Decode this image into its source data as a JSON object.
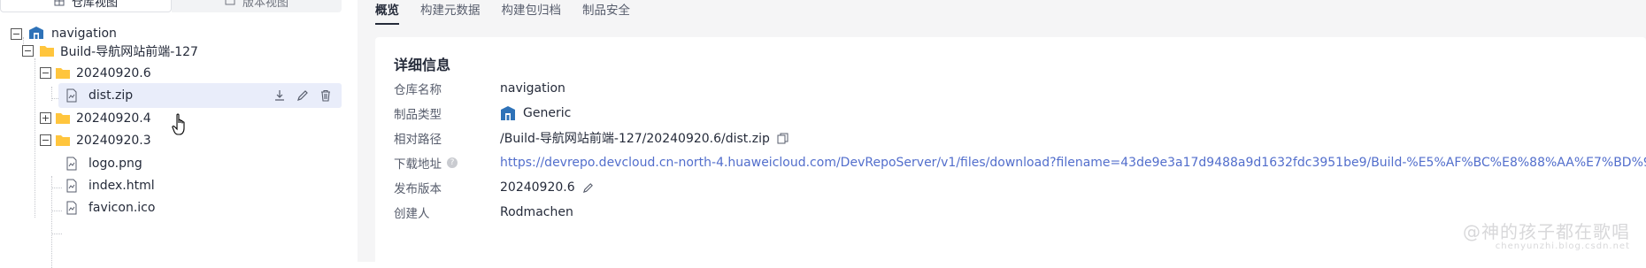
{
  "view_tabs": {
    "repo_view": "仓库视图",
    "version_view": "版本视图"
  },
  "tree": {
    "root": "navigation",
    "build": "Build-导航网站前端-127",
    "v1": "20240920.6",
    "v1_file": "dist.zip",
    "v2": "20240920.4",
    "v3": "20240920.3",
    "v3_files": [
      "logo.png",
      "index.html",
      "favicon.ico"
    ]
  },
  "content_tabs": [
    "概览",
    "构建元数据",
    "构建包归档",
    "制品安全"
  ],
  "detail": {
    "title": "详细信息",
    "rows": [
      {
        "label": "仓库名称",
        "value": "navigation"
      },
      {
        "label": "制品类型",
        "value": "Generic"
      },
      {
        "label": "相对路径",
        "value": "/Build-导航网站前端-127/20240920.6/dist.zip"
      },
      {
        "label": "下载地址",
        "value": "https://devrepo.devcloud.cn-north-4.huaweicloud.com/DevRepoServer/v1/files/download?filename=43de9e3a17d9488a9d1632fdc3951be9/Build-%E5%AF%BC%E8%88%AA%E7%BD%91%E7..."
      },
      {
        "label": "发布版本",
        "value": "20240920.6"
      },
      {
        "label": "创建人",
        "value": "Rodmachen"
      }
    ]
  },
  "watermark": {
    "line1": "@神的孩子都在歌唱",
    "line2": "chenyunzhi.blog.csdn.net"
  },
  "colors": {
    "accent": "#526ecc",
    "folder": "#ffc53d",
    "repo_icon": "#2e72b8",
    "selected_row": "#e9edfa"
  }
}
